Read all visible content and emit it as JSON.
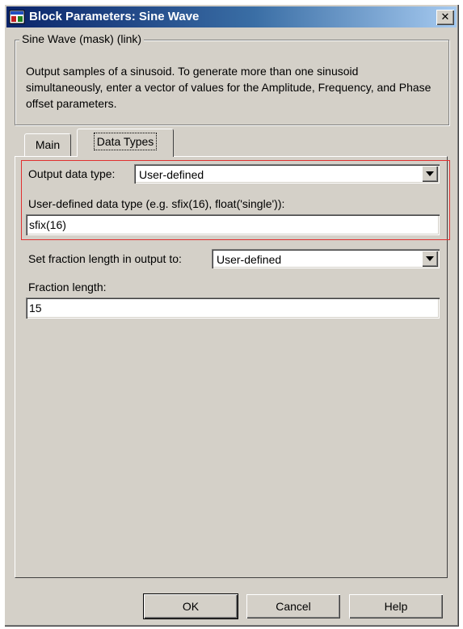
{
  "window": {
    "title": "Block Parameters: Sine Wave",
    "close_glyph": "✕"
  },
  "mask_group": {
    "legend": "Sine Wave (mask) (link)",
    "description": "Output samples of a sinusoid.  To generate more than one sinusoid simultaneously, enter a vector of values for the Amplitude, Frequency, and Phase offset parameters."
  },
  "tabs": [
    {
      "label": "Main",
      "selected": false
    },
    {
      "label": "Data Types",
      "selected": true
    }
  ],
  "data_types": {
    "output_data_type": {
      "label": "Output data type:",
      "value": "User-defined"
    },
    "user_defined_type": {
      "label": "User-defined data type (e.g. sfix(16), float('single')):",
      "value": "sfix(16)"
    },
    "fraction_mode": {
      "label": "Set fraction length in output to:",
      "value": "User-defined"
    },
    "fraction_length": {
      "label": "Fraction length:",
      "value": "15"
    }
  },
  "buttons": {
    "ok": "OK",
    "cancel": "Cancel",
    "help": "Help"
  },
  "colors": {
    "title_start": "#0a246a",
    "title_end": "#a6caf0",
    "dialog_face": "#d4d0c8",
    "highlight_box": "#e03030"
  },
  "icons": {
    "title": "simulink-block-icon",
    "dropdown": "chevron-down-icon"
  }
}
